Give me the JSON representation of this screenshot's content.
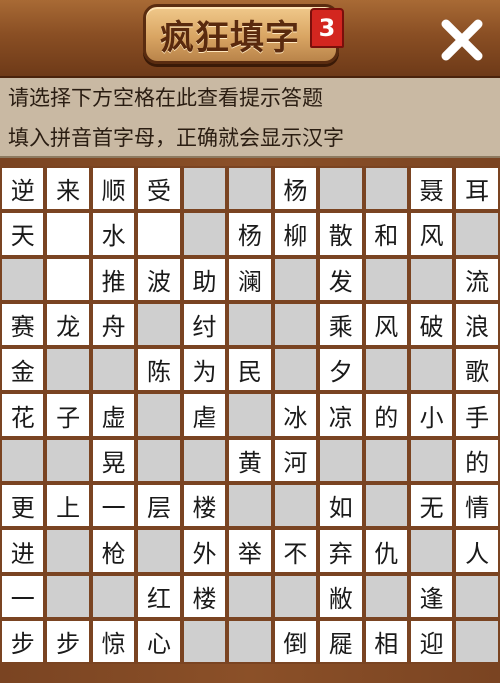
{
  "header": {
    "title": "疯狂填字",
    "level": "3",
    "close_icon": "close-icon"
  },
  "hint": {
    "line1": "请选择下方空格在此查看提示答题",
    "line2": "填入拼音首字母，正确就会显示汉字"
  },
  "grid": [
    [
      "逆",
      "来",
      "顺",
      "受",
      null,
      null,
      "杨",
      null,
      null,
      "聂",
      "耳"
    ],
    [
      "天",
      "",
      "水",
      "",
      null,
      "杨",
      "柳",
      "散",
      "和",
      "风",
      null
    ],
    [
      null,
      "",
      "推",
      "波",
      "助",
      "澜",
      null,
      "发",
      null,
      null,
      "流"
    ],
    [
      "赛",
      "龙",
      "舟",
      null,
      "纣",
      null,
      null,
      "乘",
      "风",
      "破",
      "浪"
    ],
    [
      "金",
      null,
      null,
      "陈",
      "为",
      "民",
      null,
      "夕",
      null,
      null,
      "歌"
    ],
    [
      "花",
      "子",
      "虚",
      null,
      "虐",
      null,
      "冰",
      "凉",
      "的",
      "小",
      "手"
    ],
    [
      null,
      null,
      "晃",
      null,
      null,
      "黄",
      "河",
      null,
      null,
      null,
      "的"
    ],
    [
      "更",
      "上",
      "一",
      "层",
      "楼",
      null,
      null,
      "如",
      null,
      "无",
      "情"
    ],
    [
      "进",
      null,
      "枪",
      null,
      "外",
      "举",
      "不",
      "弃",
      "仇",
      null,
      "人"
    ],
    [
      "一",
      null,
      null,
      "红",
      "楼",
      null,
      null,
      "敝",
      null,
      "逢",
      null
    ],
    [
      "步",
      "步",
      "惊",
      "心",
      null,
      null,
      "倒",
      "屣",
      "相",
      "迎",
      null
    ]
  ],
  "colors": {
    "board": "#7a4422",
    "filled_cell": "#ffffff",
    "blocked_cell": "#cfcfcf",
    "badge": "#d3261f"
  }
}
